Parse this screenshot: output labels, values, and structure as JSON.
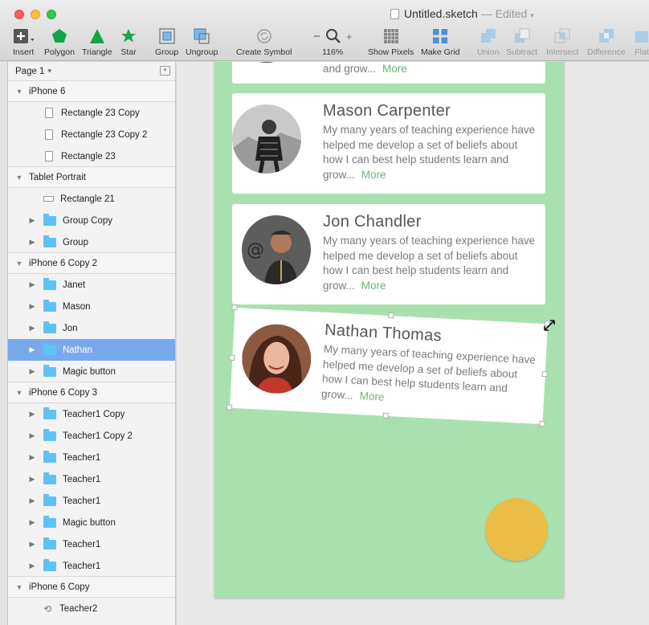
{
  "window": {
    "title": "Untitled.sketch",
    "status": "— Edited"
  },
  "toolbar": {
    "insert": "Insert",
    "polygon": "Polygon",
    "triangle": "Triangle",
    "star": "Star",
    "group": "Group",
    "ungroup": "Ungroup",
    "create_symbol": "Create Symbol",
    "zoom_minus": "−",
    "zoom_plus": "+",
    "zoom_level": "116%",
    "show_pixels": "Show Pixels",
    "make_grid": "Make Grid",
    "union": "Union",
    "subtract": "Subtract",
    "intersect": "Intersect",
    "difference": "Difference",
    "flatten": "Flat"
  },
  "sidebar": {
    "page": "Page 1",
    "rows": [
      {
        "label": "iPhone 6",
        "type": "artboard"
      },
      {
        "label": "Rectangle 23 Copy",
        "type": "rect"
      },
      {
        "label": "Rectangle 23 Copy 2",
        "type": "rect"
      },
      {
        "label": "Rectangle 23",
        "type": "rect"
      },
      {
        "label": "Tablet Portrait",
        "type": "artboard"
      },
      {
        "label": "Rectangle 21",
        "type": "rect-wide"
      },
      {
        "label": "Group Copy",
        "type": "folder"
      },
      {
        "label": "Group",
        "type": "folder"
      },
      {
        "label": "iPhone 6 Copy 2",
        "type": "artboard"
      },
      {
        "label": "Janet",
        "type": "folder"
      },
      {
        "label": "Mason",
        "type": "folder"
      },
      {
        "label": "Jon",
        "type": "folder"
      },
      {
        "label": "Nathan",
        "type": "folder",
        "selected": true
      },
      {
        "label": "Magic button",
        "type": "folder"
      },
      {
        "label": "iPhone 6 Copy 3",
        "type": "artboard"
      },
      {
        "label": "Teacher1 Copy",
        "type": "folder"
      },
      {
        "label": "Teacher1 Copy 2",
        "type": "folder"
      },
      {
        "label": "Teacher1",
        "type": "folder"
      },
      {
        "label": "Teacher1",
        "type": "folder"
      },
      {
        "label": "Teacher1",
        "type": "folder"
      },
      {
        "label": "Magic button",
        "type": "folder"
      },
      {
        "label": "Teacher1",
        "type": "folder"
      },
      {
        "label": "Teacher1",
        "type": "folder"
      },
      {
        "label": "iPhone 6 Copy",
        "type": "artboard"
      },
      {
        "label": "Teacher2",
        "type": "symbol"
      }
    ]
  },
  "cards": [
    {
      "name": "",
      "bio": "and grow...",
      "more": "More"
    },
    {
      "name": "Mason Carpenter",
      "bio": "My many years of teaching experience have helped me develop a set of beliefs about how I can best help students learn and grow...",
      "more": "More"
    },
    {
      "name": "Jon Chandler",
      "bio": "My many years of teaching experience have helped me develop a set of beliefs about how I can best help students learn and grow...",
      "more": "More"
    },
    {
      "name": "Nathan Thomas",
      "bio": "My many years of teaching experience have helped me develop a set of beliefs about how I can best help students learn and grow...",
      "more": "More"
    }
  ],
  "colors": {
    "artboard": "#a8e1ad",
    "accent_more": "#6fb57b",
    "fab": "#ecbd46",
    "selection": "#78a9ec",
    "folder": "#5ec2f5"
  }
}
